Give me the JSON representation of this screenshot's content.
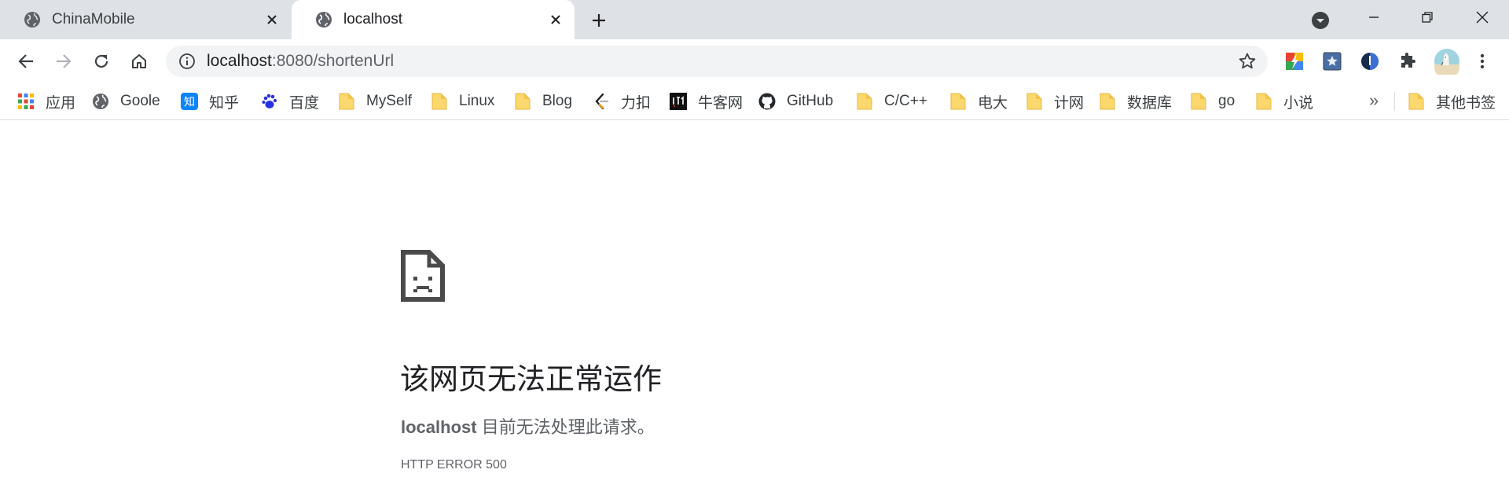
{
  "tabs": [
    {
      "title": "ChinaMobile",
      "active": false
    },
    {
      "title": "localhost",
      "active": true
    }
  ],
  "omnibox": {
    "host": "localhost",
    "path": ":8080/shortenUrl"
  },
  "bookmarks": [
    {
      "label": "应用",
      "icon": "apps-grid-icon"
    },
    {
      "label": "Goole",
      "icon": "globe-icon"
    },
    {
      "label": "知乎",
      "icon": "zhihu-icon"
    },
    {
      "label": "百度",
      "icon": "baidu-paw-icon"
    },
    {
      "label": "MySelf",
      "icon": "folder-icon"
    },
    {
      "label": "Linux",
      "icon": "folder-icon"
    },
    {
      "label": "Blog",
      "icon": "folder-icon"
    },
    {
      "label": "力扣",
      "icon": "leetcode-icon"
    },
    {
      "label": "牛客网",
      "icon": "nowcoder-icon"
    },
    {
      "label": "GitHub",
      "icon": "github-icon"
    },
    {
      "label": "C/C++",
      "icon": "folder-icon"
    },
    {
      "label": "电大",
      "icon": "folder-icon"
    },
    {
      "label": "计网",
      "icon": "folder-icon"
    },
    {
      "label": "数据库",
      "icon": "folder-icon"
    },
    {
      "label": "go",
      "icon": "folder-icon"
    },
    {
      "label": "小说",
      "icon": "folder-icon"
    }
  ],
  "bookmarks_more": "»",
  "other_bookmarks": "其他书签",
  "error": {
    "title": "该网页无法正常运作",
    "host": "localhost",
    "message": " 目前无法处理此请求。",
    "code": "HTTP ERROR 500"
  },
  "colors": {
    "tabstrip_bg": "#dee1e6",
    "omnibox_bg": "#f1f3f4",
    "folder_yellow": "#fbd86d",
    "text_secondary": "#5f6368"
  }
}
